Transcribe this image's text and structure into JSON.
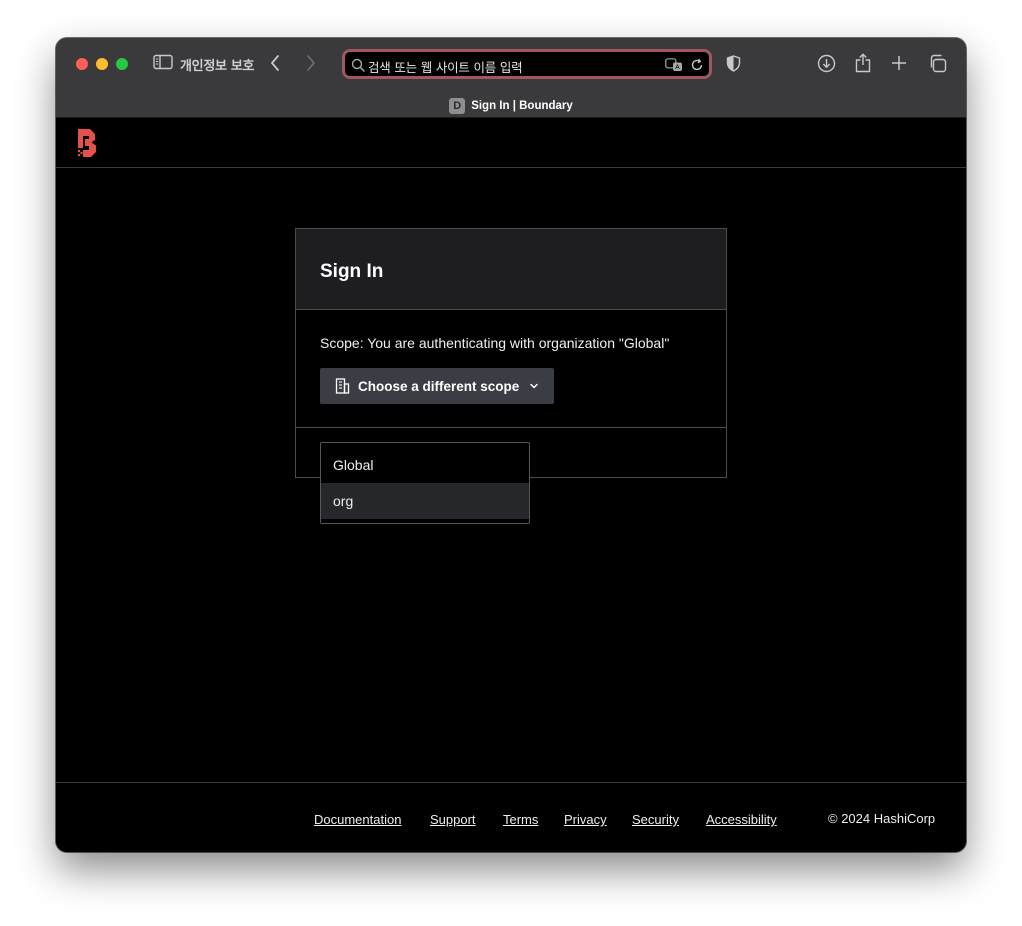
{
  "browser": {
    "privacy_label": "개인정보 보호",
    "address_placeholder": "검색 또는 웹 사이트 이름 입력",
    "tab_favicon_letter": "D",
    "tab_title": "Sign In | Boundary",
    "icons": [
      "sidebar-icon",
      "back-icon",
      "forward-icon",
      "search-icon",
      "translate-icon",
      "reload-icon",
      "shield-icon",
      "download-icon",
      "share-icon",
      "new-tab-icon",
      "tab-overview-icon"
    ]
  },
  "app": {
    "logo": "boundary-logo",
    "accent_color": "#e2514a"
  },
  "signin": {
    "title": "Sign In",
    "scope_text": "Scope: You are authenticating with organization \"Global\"",
    "scope_button_label": "Choose a different scope",
    "scope_options": [
      "Global",
      "org"
    ],
    "highlighted_option": "org"
  },
  "footer": {
    "links": [
      "Documentation",
      "Support",
      "Terms",
      "Privacy",
      "Security",
      "Accessibility"
    ],
    "copyright": "© 2024 HashiCorp"
  }
}
